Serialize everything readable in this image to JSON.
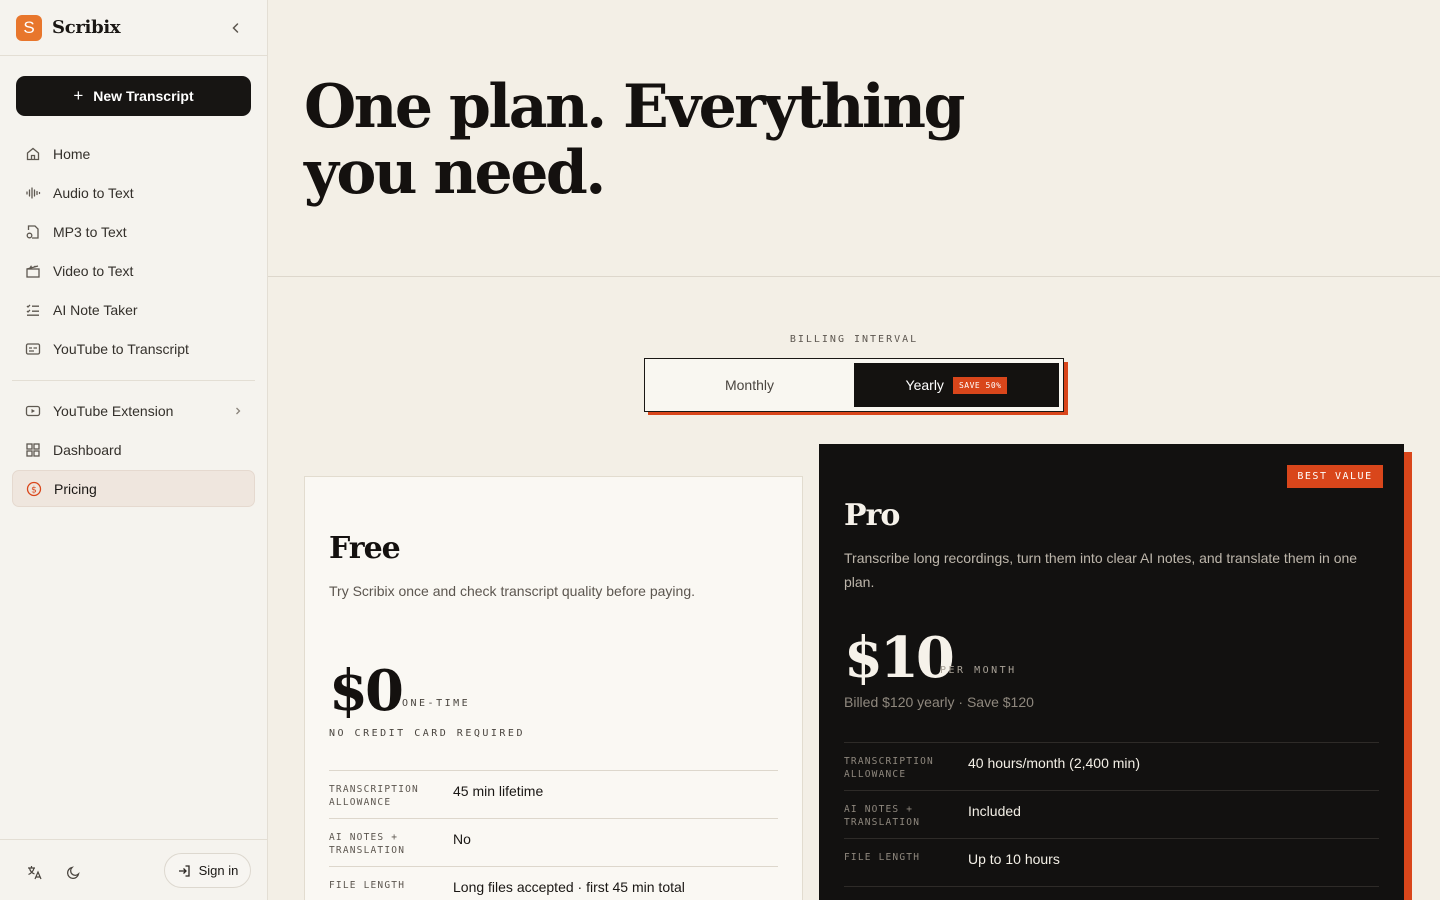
{
  "app": {
    "name": "Scribix",
    "logo_letter": "S"
  },
  "sidebar": {
    "new_button": "New Transcript",
    "items_primary": [
      {
        "label": "Home",
        "icon": "home-icon"
      },
      {
        "label": "Audio to Text",
        "icon": "audio-wave-icon"
      },
      {
        "label": "MP3 to Text",
        "icon": "file-audio-icon"
      },
      {
        "label": "Video to Text",
        "icon": "clapperboard-icon"
      },
      {
        "label": "AI Note Taker",
        "icon": "list-checks-icon"
      },
      {
        "label": "YouTube to Transcript",
        "icon": "captions-icon"
      }
    ],
    "items_secondary": [
      {
        "label": "YouTube Extension",
        "icon": "youtube-icon"
      },
      {
        "label": "Dashboard",
        "icon": "dashboard-icon"
      },
      {
        "label": "Pricing",
        "icon": "dollar-circle-icon",
        "active": true
      }
    ],
    "sign_in": "Sign in"
  },
  "hero": {
    "title": "One plan. Everything you need."
  },
  "billing": {
    "label": "BILLING INTERVAL",
    "monthly": "Monthly",
    "yearly": "Yearly",
    "save_badge": "SAVE 50%",
    "selected": "Yearly"
  },
  "plans": {
    "free": {
      "name": "Free",
      "description": "Try Scribix once and check transcript quality before paying.",
      "price": "$0",
      "price_unit": "ONE-TIME",
      "note": "NO CREDIT CARD REQUIRED",
      "features": [
        {
          "label": "TRANSCRIPTION ALLOWANCE",
          "value": "45 min lifetime"
        },
        {
          "label": "AI NOTES + TRANSLATION",
          "value": "No"
        },
        {
          "label": "FILE LENGTH",
          "value": "Long files accepted · first 45 min total"
        }
      ]
    },
    "pro": {
      "name": "Pro",
      "badge": "BEST VALUE",
      "description": "Transcribe long recordings, turn them into clear AI notes, and translate them in one plan.",
      "price": "$10",
      "price_unit": "PER MONTH",
      "note": "Billed $120 yearly · Save $120",
      "features": [
        {
          "label": "TRANSCRIPTION ALLOWANCE",
          "value": "40 hours/month (2,400 min)"
        },
        {
          "label": "AI NOTES + TRANSLATION",
          "value": "Included"
        },
        {
          "label": "FILE LENGTH",
          "value": "Up to 10 hours"
        }
      ]
    }
  },
  "colors": {
    "accent": "#d9461b",
    "logo": "#e8762c",
    "dark": "#121110",
    "background": "#f3efe6"
  }
}
